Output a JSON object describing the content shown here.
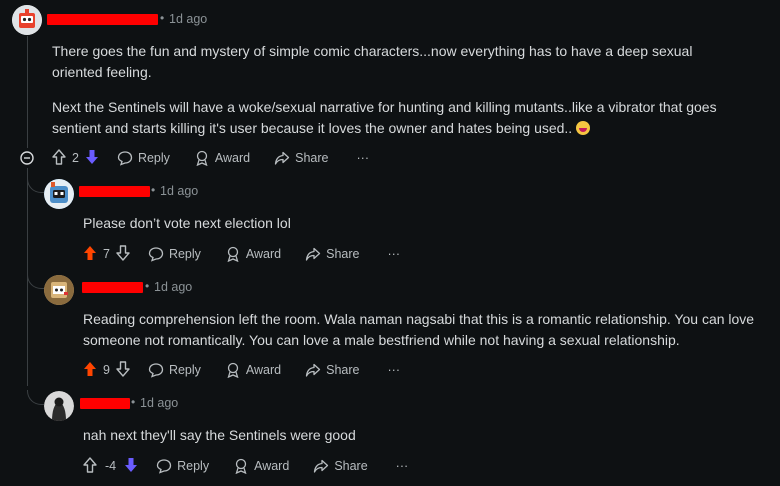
{
  "comments": [
    {
      "time": "1d ago",
      "paragraphs": [
        "There goes the fun and mystery of simple comic characters...now everything has to have a deep sexual oriented feeling.",
        "Next the Sentinels will have a woke/sexual narrative for hunting and killing mutants..like a vibrator that goes sentient and starts killing it's user because it loves the owner and hates being used.."
      ],
      "votes": "2",
      "vote_state": "downvoted"
    },
    {
      "time": "1d ago",
      "paragraphs": [
        "Please don’t vote next election lol"
      ],
      "votes": "7",
      "vote_state": "upvoted"
    },
    {
      "time": "1d ago",
      "paragraphs": [
        "Reading comprehension left the room. Wala naman nagsabi that this is a romantic relationship. You can love someone not romantically. You can love a male bestfriend while not having a sexual relationship."
      ],
      "votes": "9",
      "vote_state": "upvoted"
    },
    {
      "time": "1d ago",
      "paragraphs": [
        "nah next they'll say the Sentinels were good"
      ],
      "votes": "-4",
      "vote_state": "downvoted"
    }
  ],
  "actions": {
    "reply": "Reply",
    "award": "Award",
    "share": "Share",
    "more": "···"
  },
  "colors": {
    "background": "#0e1113",
    "upvote": "#ff4500",
    "downvote": "#6a5cff",
    "redaction": "#ff0000"
  }
}
